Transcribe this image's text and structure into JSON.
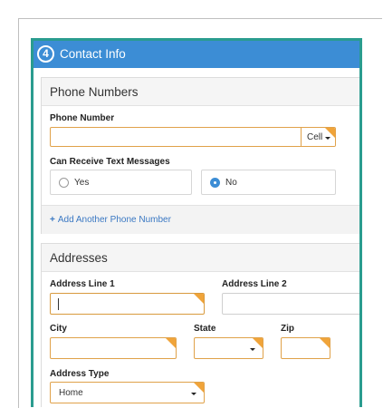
{
  "panel": {
    "step": "4",
    "title": "Contact Info"
  },
  "phone": {
    "section_title": "Phone Numbers",
    "phone_label": "Phone Number",
    "phone_value": "",
    "phone_type": "Cell",
    "text_label": "Can Receive Text Messages",
    "options": [
      {
        "label": "Yes",
        "selected": false
      },
      {
        "label": "No",
        "selected": true
      }
    ],
    "add_link": "Add Another Phone Number"
  },
  "addresses": {
    "section_title": "Addresses",
    "line1_label": "Address Line 1",
    "line1_value": "",
    "line2_label": "Address Line 2",
    "line2_value": "",
    "city_label": "City",
    "city_value": "",
    "state_label": "State",
    "state_value": "",
    "zip_label": "Zip",
    "zip_value": "",
    "type_label": "Address Type",
    "type_value": "Home"
  },
  "colors": {
    "header": "#3c8dd5",
    "panel_border": "#2a9c8f",
    "required_accent": "#f0a43a",
    "link": "#3a78c3"
  }
}
